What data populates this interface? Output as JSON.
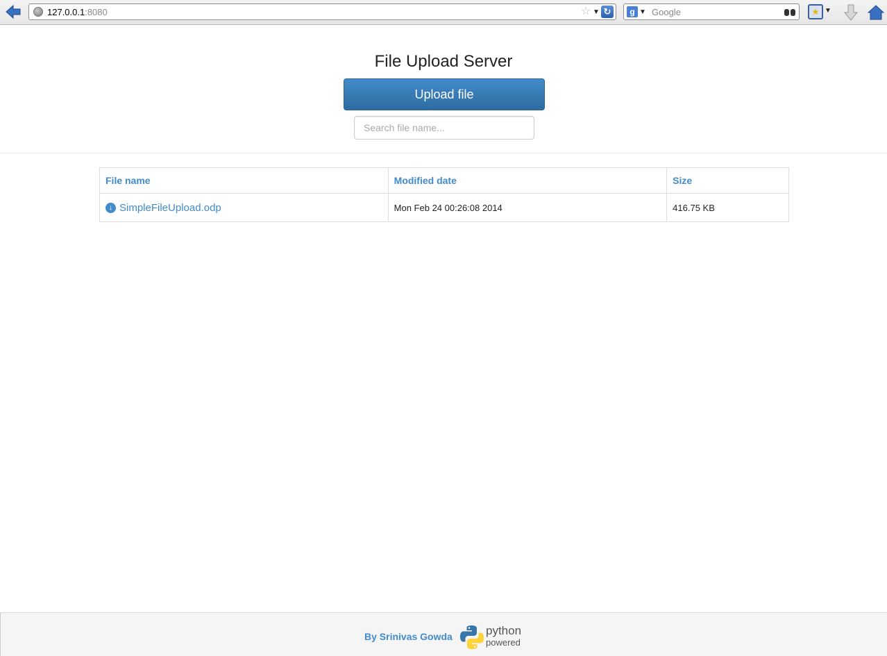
{
  "browser": {
    "url_host": "127.0.0.1",
    "url_port": ":8080",
    "search_placeholder": "Google",
    "search_engine_icon": "google-icon"
  },
  "header": {
    "title": "File Upload Server",
    "upload_label": "Upload file",
    "search_placeholder": "Search file name..."
  },
  "table": {
    "columns": [
      "File name",
      "Modified date",
      "Size"
    ],
    "rows": [
      {
        "name": "SimpleFileUpload.odp",
        "modified": "Mon Feb 24 00:26:08 2014",
        "size": "416.75 KB"
      }
    ]
  },
  "footer": {
    "author": "By Srinivas Gowda",
    "python_line1": "python",
    "python_line2": "powered"
  },
  "colors": {
    "primary": "#428bca",
    "python_blue": "#3776ab",
    "python_yellow": "#ffd43b"
  }
}
